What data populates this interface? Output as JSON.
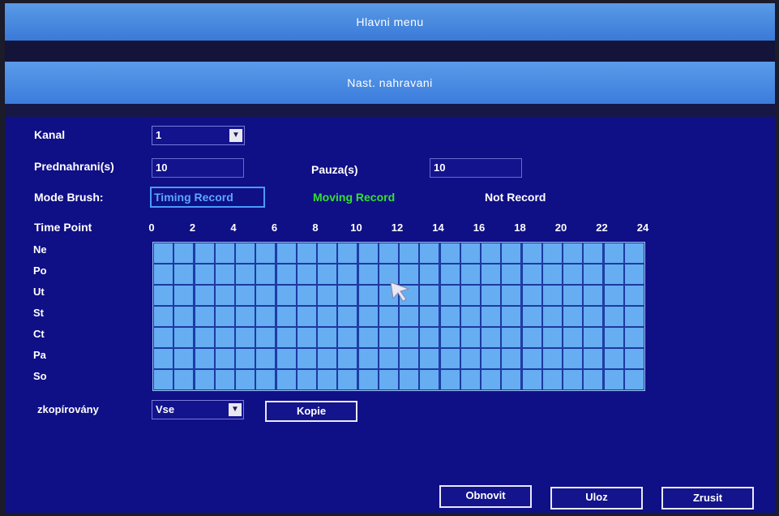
{
  "window": {
    "title": "Hlavni menu",
    "subtitle": "Nast.  nahravani"
  },
  "form": {
    "kanal_label": "Kanal",
    "kanal_value": "1",
    "prednahrani_label": "Prednahrani(s)",
    "prednahrani_value": "10",
    "pauza_label": "Pauza(s)",
    "pauza_value": "10",
    "mode_label": "Mode Brush:",
    "brush_options": [
      "Timing Record",
      "Moving Record",
      "Not Record"
    ],
    "brush_selected": "Timing Record"
  },
  "schedule": {
    "time_point_label": "Time Point",
    "hours": [
      "0",
      "2",
      "4",
      "6",
      "8",
      "10",
      "12",
      "14",
      "16",
      "18",
      "20",
      "22",
      "24"
    ],
    "days": [
      "Ne",
      "Po",
      "Ut",
      "St",
      "Ct",
      "Pa",
      "So"
    ],
    "cell_state": "Timing Record"
  },
  "copy": {
    "label": "zkopírovány",
    "value": "Vse",
    "button": "Kopie"
  },
  "actions": {
    "refresh": "Obnovit",
    "save": "Uloz",
    "cancel": "Zrusit"
  },
  "colors": {
    "background": "#0f0f86",
    "bar": "#4a8ae2",
    "cell": "#66adf2",
    "moving": "#33e033",
    "timing": "#5aa8ff"
  }
}
